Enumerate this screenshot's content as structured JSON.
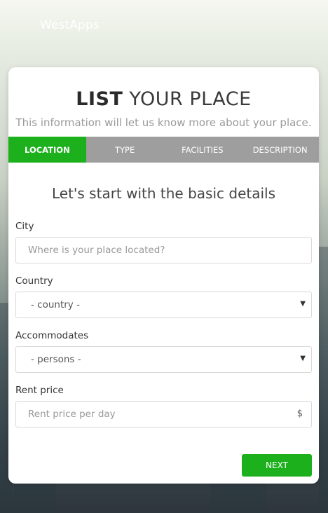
{
  "brand": {
    "name": "WestApps"
  },
  "header": {
    "title_bold": "LIST",
    "title_light": "YOUR PLACE",
    "subtitle": "This information will let us know more about your place."
  },
  "tabs": [
    {
      "label": "LOCATION",
      "active": true
    },
    {
      "label": "TYPE",
      "active": false
    },
    {
      "label": "FACILITIES",
      "active": false
    },
    {
      "label": "DESCRIPTION",
      "active": false
    }
  ],
  "form": {
    "section_title": "Let's start with the basic details",
    "city": {
      "label": "City",
      "placeholder": "Where is your place located?",
      "value": ""
    },
    "country": {
      "label": "Country",
      "selected": "- country -"
    },
    "accommodates": {
      "label": "Accommodates",
      "selected": "- persons -"
    },
    "rent": {
      "label": "Rent price",
      "placeholder": "Rent price per day",
      "suffix": "$"
    }
  },
  "actions": {
    "next_label": "NEXT"
  },
  "colors": {
    "accent": "#1cb01c",
    "tab_inactive": "#9e9e9e"
  }
}
